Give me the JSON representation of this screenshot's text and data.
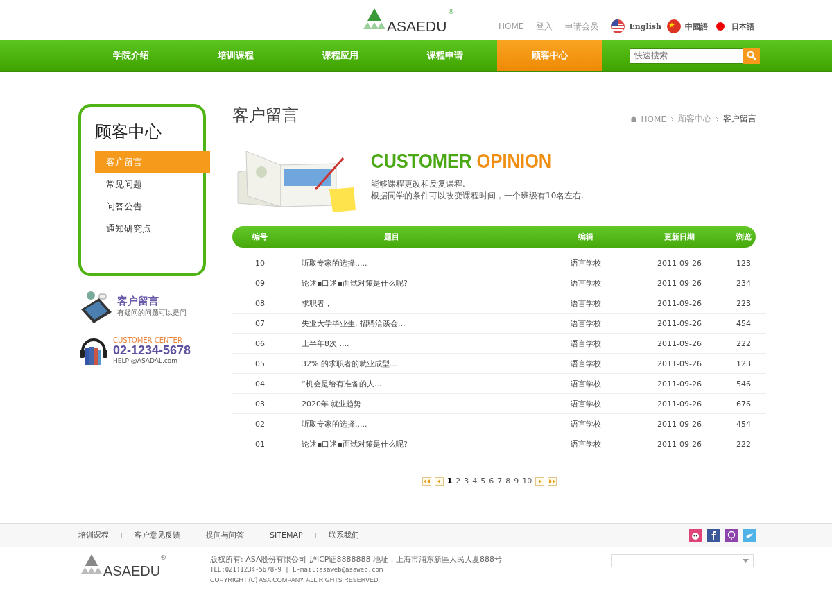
{
  "header": {
    "logo": "ASAEDU",
    "logo_mark": "®",
    "top_links": [
      "HOME",
      "登入",
      "申请会员"
    ],
    "languages": [
      {
        "label": "English",
        "kind": "us"
      },
      {
        "label": "中國語",
        "kind": "cn"
      },
      {
        "label": "日本語",
        "kind": "jp"
      }
    ]
  },
  "nav": [
    {
      "label": "学院介绍",
      "selected": false
    },
    {
      "label": "培训课程",
      "selected": false
    },
    {
      "label": "课程应用",
      "selected": false
    },
    {
      "label": "课程申请",
      "selected": false
    },
    {
      "label": "顾客中心",
      "selected": true
    }
  ],
  "search": {
    "placeholder": "快速搜索"
  },
  "sidebar": {
    "title": "顾客中心",
    "items": [
      {
        "label": "客户留言",
        "selected": true
      },
      {
        "label": "常见问题",
        "selected": false
      },
      {
        "label": "问答公告",
        "selected": false
      },
      {
        "label": "通知研究点",
        "selected": false
      }
    ],
    "promo": {
      "title": "客户留言",
      "subtitle": "有疑问的问题可以提问"
    },
    "contact": {
      "label": "CUSTOMER CENTER",
      "phone": "02-1234-5678",
      "email": "HELP @ASADAL.com"
    }
  },
  "page_title": "客户留言",
  "breadcrumb": [
    "HOME",
    "顾客中心",
    "客户留言"
  ],
  "banner": {
    "title_green": "CUSTOMER",
    "title_orange": "OPINION",
    "lines": [
      "能够课程更改和反复课程.",
      "根据同学的条件可以改变课程时间，一个班级有10名左右."
    ]
  },
  "table": {
    "columns": [
      "编号",
      "题目",
      "编辑",
      "更新日期",
      "浏览"
    ],
    "rows": [
      [
        "10",
        "听取专家的选择.....",
        "语言学校",
        "2011-09-26",
        "123"
      ],
      [
        "09",
        "论述▪口述▪面试对策是什么呢?",
        "语言学校",
        "2011-09-26",
        "234"
      ],
      [
        "08",
        "求职者，",
        "语言学校",
        "2011-09-26",
        "223"
      ],
      [
        "07",
        "失业大学毕业生, 招聘洽谈会...",
        "语言学校",
        "2011-09-26",
        "454"
      ],
      [
        "06",
        "上半年8次 ....",
        "语言学校",
        "2011-09-26",
        "222"
      ],
      [
        "05",
        "32% 的求职者的就业成型...",
        "语言学校",
        "2011-09-26",
        "123"
      ],
      [
        "04",
        "“机会是给有准备的人...",
        "语言学校",
        "2011-09-26",
        "546"
      ],
      [
        "03",
        "2020年 就业趋势",
        "语言学校",
        "2011-09-26",
        "676"
      ],
      [
        "02",
        "听取专家的选择.....",
        "语言学校",
        "2011-09-26",
        "454"
      ],
      [
        "01",
        "论述▪口述▪面试对策是什么呢?",
        "语言学校",
        "2011-09-26",
        "222"
      ]
    ]
  },
  "pagination": [
    {
      "label": "1",
      "selected": true
    },
    {
      "label": "2",
      "selected": false
    },
    {
      "label": "3",
      "selected": false
    },
    {
      "label": "4",
      "selected": false
    },
    {
      "label": "5",
      "selected": false
    },
    {
      "label": "6",
      "selected": false
    },
    {
      "label": "7",
      "selected": false
    },
    {
      "label": "8",
      "selected": false
    },
    {
      "label": "9",
      "selected": false
    },
    {
      "label": "10",
      "selected": false
    }
  ],
  "footer": {
    "links": [
      "培训课程",
      "客户意见反馈",
      "提问与问答",
      "SITEMAP",
      "联系我们"
    ],
    "social": [
      {
        "kind": "face",
        "color": "#e0457a"
      },
      {
        "kind": "f",
        "color": "#3b5998"
      },
      {
        "kind": "pin",
        "color": "#8e44ad"
      },
      {
        "kind": "bird",
        "color": "#4fb3e8"
      }
    ],
    "logo": "ASAEDU",
    "logo_mark": "®",
    "lines": [
      "版权所有: ASA股份有限公司 沪ICP证8888888 地址：上海市浦东新區人民大夏888号",
      "TEL:021)1234-5678-9 | E-mail:asaweb@asaweb.com",
      "COPYRIGHT (C) ASA COMPANY. ALL RIGHTS RESERVED."
    ]
  }
}
